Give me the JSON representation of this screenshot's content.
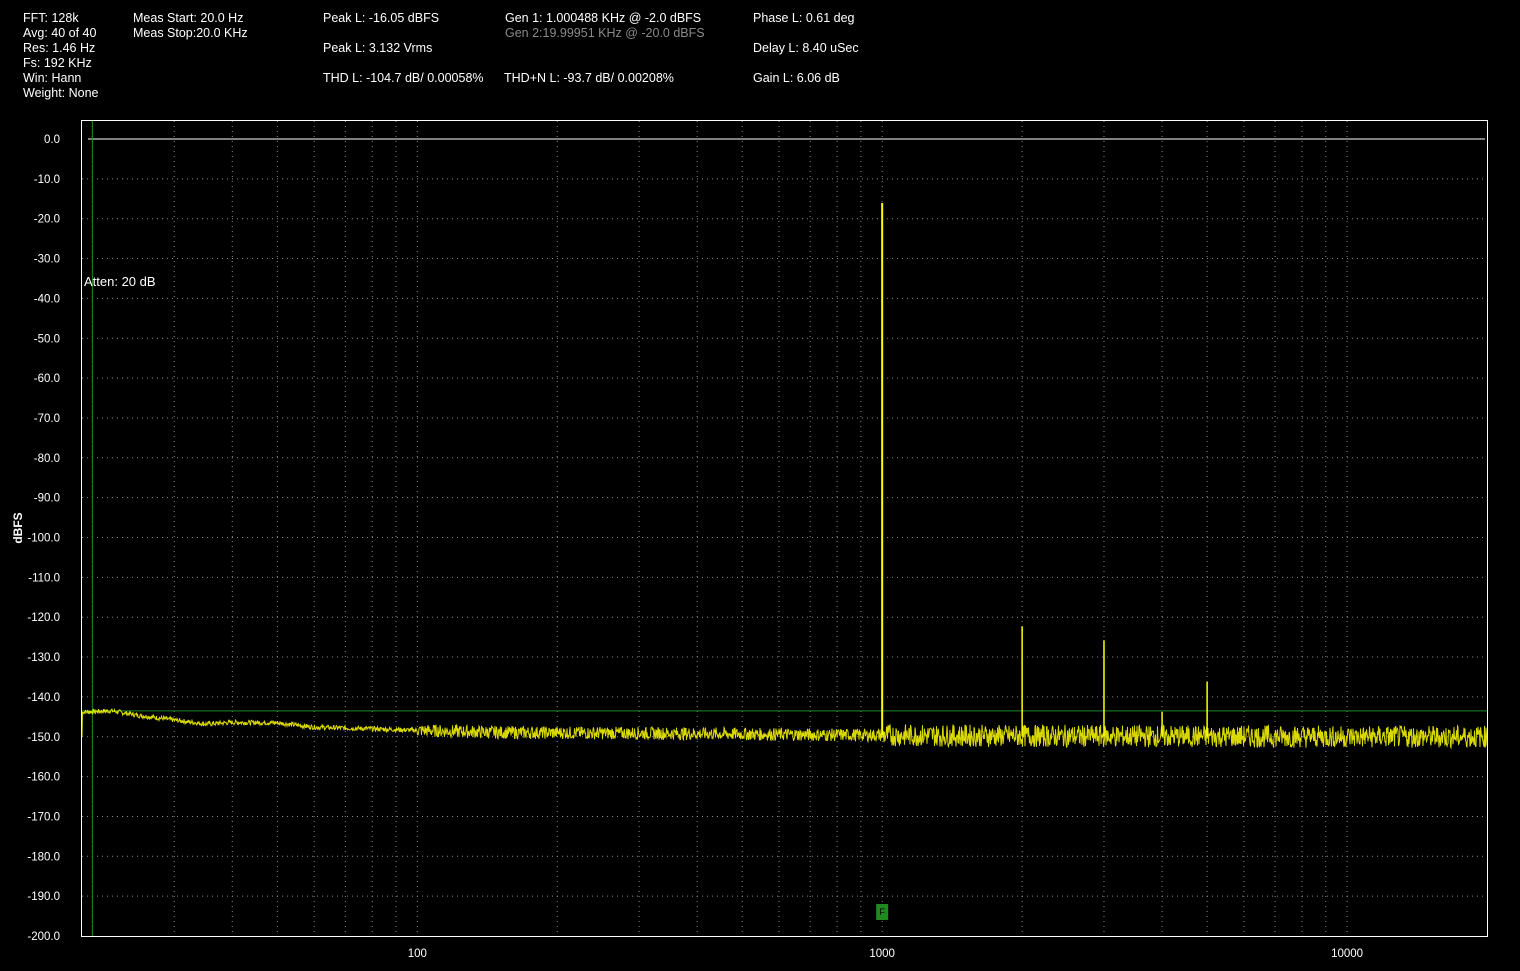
{
  "header": {
    "fft": "FFT: 128k",
    "avg": "Avg: 40 of 40",
    "res": "Res: 1.46 Hz",
    "fs": "Fs: 192 KHz",
    "win": "Win: Hann",
    "weight": "Weight: None",
    "meas_start": "Meas Start: 20.0 Hz",
    "meas_stop": "Meas Stop:20.0 KHz",
    "peak_dbfs": "Peak L: -16.05 dBFS",
    "peak_vrms": "Peak L: 3.132 Vrms",
    "thd": "THD L: -104.7 dB/ 0.00058%",
    "thdn": "THD+N L: -93.7 dB/ 0.00208%",
    "gen1": "Gen 1: 1.000488 KHz @ -2.0  dBFS",
    "gen2": "Gen 2:19.99951 KHz @ -20.0  dBFS",
    "phase": "Phase L: 0.61 deg",
    "delay": "Delay L: 8.40 uSec",
    "gain": "Gain L: 6.06 dB"
  },
  "chart_data": {
    "type": "line",
    "ylabel": "dBFS",
    "xlabel": "",
    "x_scale": "log",
    "xlim": [
      19,
      20000
    ],
    "ylim": [
      -200,
      0
    ],
    "x_ticks": [
      100,
      1000,
      10000
    ],
    "x_tick_labels": [
      "100",
      "1000",
      "10000"
    ],
    "y_ticks": [
      0,
      -10,
      -20,
      -30,
      -40,
      -50,
      -60,
      -70,
      -80,
      -90,
      -100,
      -110,
      -120,
      -130,
      -140,
      -150,
      -160,
      -170,
      -180,
      -190,
      -200
    ],
    "y_tick_labels": [
      "0.0",
      "-10.0",
      "-20.0",
      "-30.0",
      "-40.0",
      "-50.0",
      "-60.0",
      "-70.0",
      "-80.0",
      "-90.0",
      "-100.0",
      "-110.0",
      "-120.0",
      "-130.0",
      "-140.0",
      "-150.0",
      "-160.0",
      "-170.0",
      "-180.0",
      "-190.0",
      "-200.0"
    ],
    "grid": true,
    "annotation": "Atten: 20 dB",
    "reference_line_db": 0,
    "noise_marker_db": -143.5,
    "start_marker_hz": 20,
    "fundamental_marker_label": "F",
    "fundamental_marker_hz": 1000,
    "series": [
      {
        "color": "#ffff00",
        "noise_floor": [
          [
            19,
            -143.8
          ],
          [
            22,
            -143.5
          ],
          [
            25,
            -144.6
          ],
          [
            30,
            -145.8
          ],
          [
            35,
            -146.8
          ],
          [
            40,
            -146.4
          ],
          [
            50,
            -146.5
          ],
          [
            60,
            -147.6
          ],
          [
            80,
            -148.0
          ],
          [
            100,
            -148.4
          ],
          [
            150,
            -148.9
          ],
          [
            200,
            -149.0
          ],
          [
            300,
            -149.1
          ],
          [
            500,
            -149.3
          ],
          [
            700,
            -149.5
          ],
          [
            1000,
            -149.6
          ],
          [
            2000,
            -149.8
          ],
          [
            5000,
            -149.9
          ],
          [
            10000,
            -150.0
          ],
          [
            20000,
            -150.0
          ]
        ],
        "peaks": [
          {
            "hz": 1000,
            "db": -16.05
          },
          {
            "hz": 2000,
            "db": -122.3
          },
          {
            "hz": 3000,
            "db": -125.8
          },
          {
            "hz": 4000,
            "db": -143.8
          },
          {
            "hz": 5000,
            "db": -136.2
          }
        ]
      }
    ]
  },
  "colors": {
    "background": "#000000",
    "trace": "#ffff00",
    "grid": "#8a8a8a",
    "marker": "#1f8a1f"
  }
}
